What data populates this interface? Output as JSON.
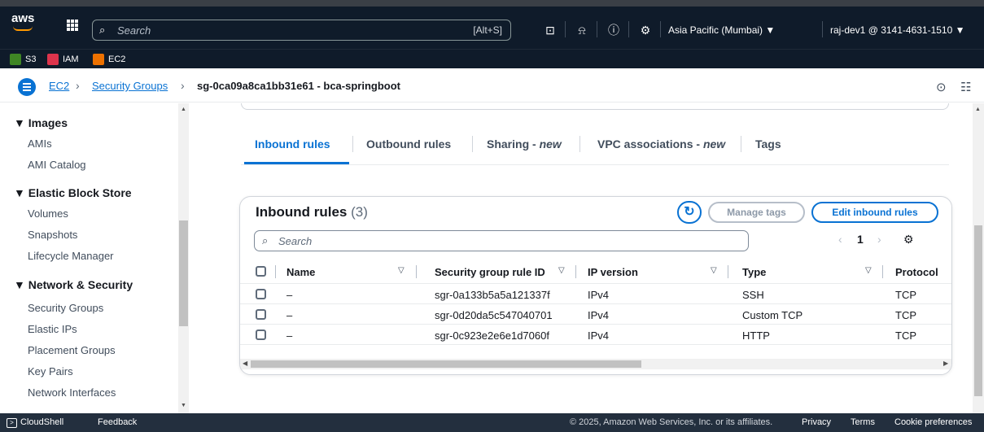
{
  "topnav": {
    "logo": "aws",
    "search_placeholder": "Search",
    "search_shortcut": "[Alt+S]",
    "region": "Asia Pacific (Mumbai) ▼",
    "account": "raj-dev1 @ 3141-4631-1510 ▼"
  },
  "favorites": [
    {
      "label": "S3",
      "color": "#3f8624"
    },
    {
      "label": "IAM",
      "color": "#dd344c"
    },
    {
      "label": "EC2",
      "color": "#ed7100"
    }
  ],
  "breadcrumb": {
    "items": [
      "EC2",
      "Security Groups"
    ],
    "current": "sg-0ca09a8ca1bb31e61 - bca-springboot"
  },
  "sidebar": {
    "sections": [
      {
        "title": "▼ Images",
        "items": [
          "AMIs",
          "AMI Catalog"
        ]
      },
      {
        "title": "▼ Elastic Block Store",
        "items": [
          "Volumes",
          "Snapshots",
          "Lifecycle Manager"
        ]
      },
      {
        "title": "▼ Network & Security",
        "items": [
          "Security Groups",
          "Elastic IPs",
          "Placement Groups",
          "Key Pairs",
          "Network Interfaces"
        ]
      }
    ]
  },
  "tabs": [
    {
      "label": "Inbound rules",
      "suffix": ""
    },
    {
      "label": "Outbound rules",
      "suffix": ""
    },
    {
      "label": "Sharing - ",
      "suffix": "new"
    },
    {
      "label": "VPC associations - ",
      "suffix": "new"
    },
    {
      "label": "Tags",
      "suffix": ""
    }
  ],
  "inbound": {
    "title": "Inbound rules",
    "count": "(3)",
    "manage_tags": "Manage tags",
    "edit_rules": "Edit inbound rules",
    "search_placeholder": "Search",
    "page": "1",
    "columns": [
      "Name",
      "Security group rule ID",
      "IP version",
      "Type",
      "Protocol"
    ],
    "rows": [
      {
        "name": "–",
        "rule_id": "sgr-0a133b5a5a121337f",
        "ip_version": "IPv4",
        "type": "SSH",
        "protocol": "TCP"
      },
      {
        "name": "–",
        "rule_id": "sgr-0d20da5c547040701",
        "ip_version": "IPv4",
        "type": "Custom TCP",
        "protocol": "TCP"
      },
      {
        "name": "–",
        "rule_id": "sgr-0c923e2e6e1d7060f",
        "ip_version": "IPv4",
        "type": "HTTP",
        "protocol": "TCP"
      }
    ]
  },
  "footer": {
    "cloudshell": "CloudShell",
    "feedback": "Feedback",
    "copyright": "© 2025, Amazon Web Services, Inc. or its affiliates.",
    "privacy": "Privacy",
    "terms": "Terms",
    "cookie": "Cookie preferences"
  }
}
